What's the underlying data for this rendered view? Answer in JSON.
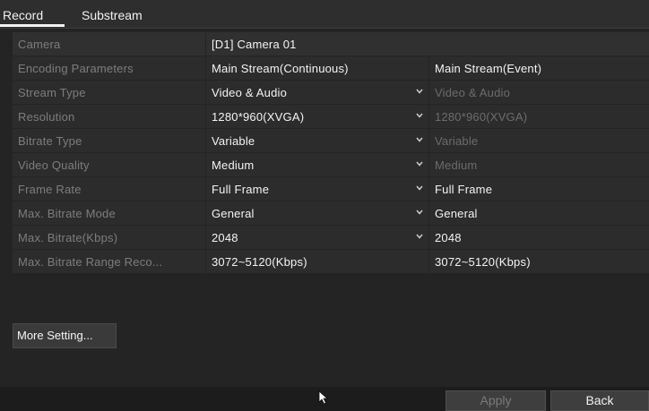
{
  "tabs": [
    {
      "label": "Record",
      "selected": true
    },
    {
      "label": "Substream",
      "selected": false
    }
  ],
  "camera": {
    "label": "Camera",
    "value": "[D1] Camera 01"
  },
  "stream_headers": {
    "label": "Encoding Parameters",
    "main_continuous": "Main Stream(Continuous)",
    "main_event": "Main Stream(Event)"
  },
  "rows": [
    {
      "label": "Stream Type",
      "continuous": "Video & Audio",
      "event": "Video & Audio",
      "event_disabled": true
    },
    {
      "label": "Resolution",
      "continuous": "1280*960(XVGA)",
      "event": "1280*960(XVGA)",
      "event_disabled": true
    },
    {
      "label": "Bitrate Type",
      "continuous": "Variable",
      "event": "Variable",
      "event_disabled": true
    },
    {
      "label": "Video Quality",
      "continuous": "Medium",
      "event": "Medium",
      "event_disabled": true
    },
    {
      "label": "Frame Rate",
      "continuous": "Full Frame",
      "event": "Full Frame",
      "event_disabled": false
    },
    {
      "label": "Max. Bitrate Mode",
      "continuous": "General",
      "event": "General",
      "event_disabled": false
    },
    {
      "label": "Max. Bitrate(Kbps)",
      "continuous": "2048",
      "event": "2048",
      "event_disabled": false
    }
  ],
  "range_row": {
    "label": "Max. Bitrate Range Reco...",
    "continuous": "3072~5120(Kbps)",
    "event": "3072~5120(Kbps)"
  },
  "more_setting_label": "More Setting...",
  "buttons": {
    "apply": "Apply",
    "back": "Back"
  },
  "colors": {
    "background": "#242424",
    "cell": "#2c2c2c",
    "label_text": "#7d7d7d",
    "value_text": "#f4f4f4"
  }
}
